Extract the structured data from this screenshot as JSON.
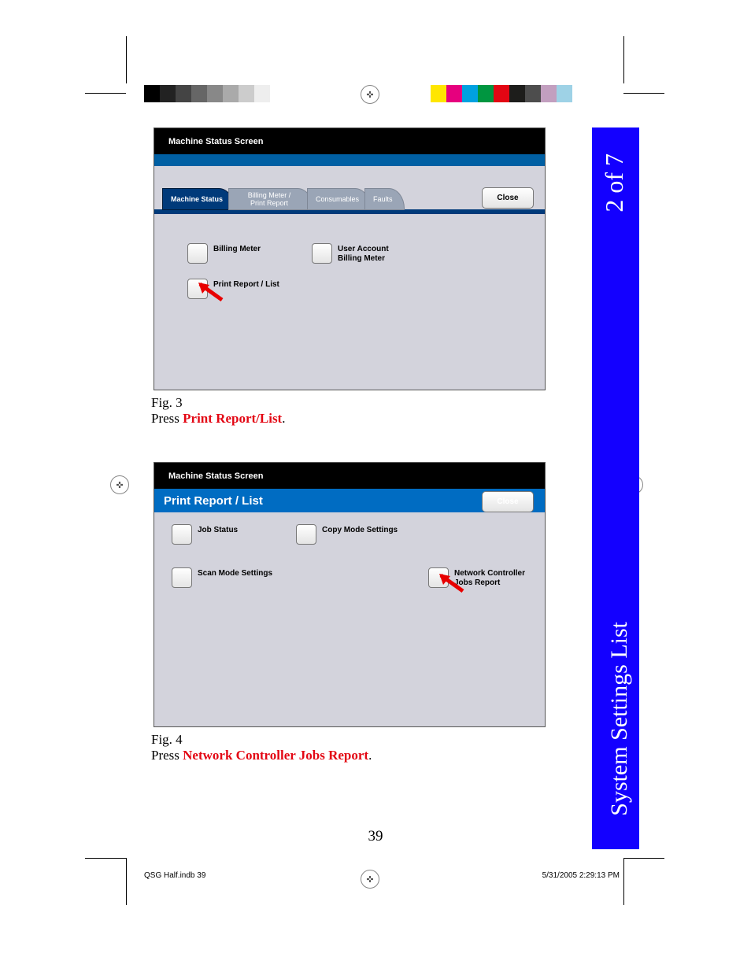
{
  "side_tab": {
    "page_of": "2 of 7",
    "section": "System Settings List"
  },
  "fig3": {
    "screen_title": "Machine Status Screen",
    "tabs": {
      "machine_status": "Machine Status",
      "billing": "Billing Meter /\nPrint Report",
      "consumables": "Consumables",
      "faults": "Faults"
    },
    "close": "Close",
    "opts": {
      "billing_meter": "Billing Meter",
      "user_account": "User Account\nBilling Meter",
      "print_report": "Print Report / List"
    },
    "caption_fig": "Fig. 3",
    "caption_pre": "Press ",
    "caption_hl": "Print Report/List",
    "caption_post": "."
  },
  "fig4": {
    "screen_title": "Machine Status Screen",
    "heading": "Print Report / List",
    "close": "Close",
    "opts": {
      "job_status": "Job Status",
      "copy_mode": "Copy Mode Settings",
      "scan_mode": "Scan Mode Settings",
      "net_ctrl": "Network Controller\nJobs Report"
    },
    "caption_fig": "Fig. 4",
    "caption_pre": "Press ",
    "caption_hl": "Network Controller Jobs Report",
    "caption_post": "."
  },
  "page_number": "39",
  "footer": {
    "left": "QSG Half.indb   39",
    "right": "5/31/2005   2:29:13 PM"
  },
  "color_bars": {
    "left": [
      "#000",
      "#222",
      "#444",
      "#666",
      "#888",
      "#aaa",
      "#ccc",
      "#eee",
      "#fff",
      "#fff",
      "#fff"
    ],
    "right": [
      "#ffe600",
      "#e6007e",
      "#00a1e0",
      "#009640",
      "#e30613",
      "#1d1d1b",
      "#4d4d4d",
      "#c29fbf",
      "#9ed2e6",
      "#fff"
    ]
  }
}
